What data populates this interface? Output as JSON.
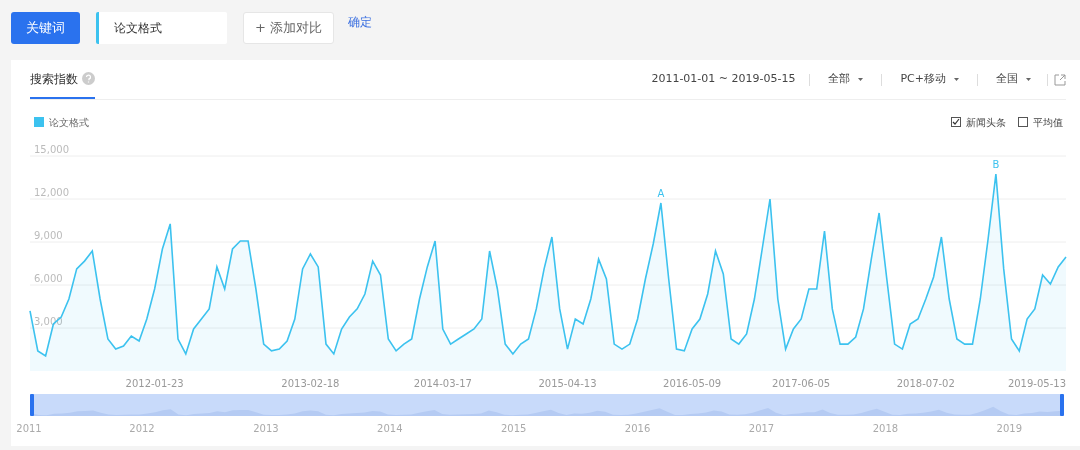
{
  "toolbar": {
    "keyword_button": "关键词",
    "keywords": [
      {
        "text": "论文格式",
        "color": "#3cc2ef"
      }
    ],
    "add_compare": "+ 添加对比",
    "confirm": "确定"
  },
  "panel": {
    "tabs": [
      {
        "label": "搜索指数",
        "selected": true
      }
    ],
    "date_range": "2011-01-01 ~ 2019-05-15",
    "dropdowns": [
      "全部",
      "PC+移动",
      "全国"
    ],
    "options": [
      {
        "label": "新闻头条",
        "checked": true
      },
      {
        "label": "平均值",
        "checked": false
      }
    ],
    "chart_data": {
      "type": "area",
      "ylim": [
        0,
        15000
      ],
      "grid": true,
      "categories": [
        null,
        null,
        null,
        null,
        null,
        null,
        null,
        null,
        null,
        null,
        null,
        null,
        null,
        null,
        null,
        null,
        "2012-01-23",
        null,
        null,
        null,
        null,
        null,
        null,
        null,
        null,
        null,
        null,
        null,
        null,
        null,
        null,
        null,
        null,
        null,
        null,
        null,
        "2013-02-18",
        null,
        null,
        null,
        null,
        null,
        null,
        null,
        null,
        null,
        null,
        null,
        null,
        null,
        null,
        null,
        null,
        "2014-03-17",
        null,
        null,
        null,
        null,
        null,
        null,
        null,
        null,
        null,
        null,
        null,
        null,
        null,
        null,
        null,
        "2015-04-13",
        null,
        null,
        null,
        null,
        null,
        null,
        null,
        null,
        null,
        null,
        null,
        null,
        null,
        null,
        null,
        "2016-05-09",
        null,
        null,
        null,
        null,
        null,
        null,
        null,
        null,
        null,
        null,
        null,
        null,
        null,
        "2017-06-05",
        null,
        null,
        null,
        null,
        null,
        null,
        null,
        null,
        null,
        null,
        null,
        null,
        null,
        null,
        null,
        "2018-07-02",
        null,
        null,
        null,
        null,
        null,
        null,
        null,
        null,
        null,
        null,
        null,
        null,
        null,
        "2019-05-13",
        null,
        null,
        null,
        null
      ],
      "series": [
        {
          "name": "论文格式",
          "color": "#3cc2ef",
          "values": [
            4190,
            1400,
            1050,
            3280,
            3770,
            5020,
            7120,
            7670,
            8370,
            5020,
            2230,
            1530,
            1740,
            2440,
            2090,
            3630,
            5720,
            8510,
            10260,
            2230,
            1190,
            2930,
            3630,
            4330,
            7260,
            5720,
            8510,
            9070,
            9070,
            5720,
            1880,
            1400,
            1530,
            2090,
            3630,
            7120,
            8160,
            7260,
            1880,
            1190,
            2930,
            3770,
            4330,
            5370,
            7670,
            6700,
            2230,
            1400,
            1880,
            2230,
            5020,
            7260,
            9070,
            2930,
            1880,
            2230,
            2580,
            2930,
            3630,
            8370,
            5720,
            1880,
            1190,
            1880,
            2230,
            4330,
            7120,
            9350,
            4330,
            1530,
            3630,
            3280,
            5020,
            7810,
            6420,
            1880,
            1530,
            1880,
            3630,
            6420,
            8860,
            11720,
            6420,
            1530,
            1400,
            2930,
            3630,
            5370,
            8370,
            6770,
            2230,
            1880,
            2580,
            5020,
            8510,
            12000,
            5020,
            1530,
            2930,
            3630,
            5720,
            5720,
            9770,
            4330,
            1880,
            1880,
            2370,
            4330,
            7810,
            11020,
            6420,
            1880,
            1530,
            3280,
            3630,
            5020,
            6560,
            9350,
            5020,
            2230,
            1880,
            1880,
            5020,
            9210,
            13740,
            7120,
            2230,
            1400,
            3630,
            4330,
            6700,
            6070,
            7260,
            7950
          ]
        }
      ],
      "yticks": [
        {
          "value": 3000,
          "label": "3,000"
        },
        {
          "value": 6000,
          "label": "6,000"
        },
        {
          "value": 9000,
          "label": "9,000"
        },
        {
          "value": 12000,
          "label": "12,000"
        },
        {
          "value": 15000,
          "label": "15,000"
        }
      ],
      "annotations": [
        {
          "y": 11720,
          "text": "A"
        },
        {
          "y": 13740,
          "text": "B"
        }
      ]
    },
    "navigator": {
      "years": [
        "2011",
        "2012",
        "2013",
        "2014",
        "2015",
        "2016",
        "2017",
        "2018",
        "2019"
      ]
    }
  }
}
